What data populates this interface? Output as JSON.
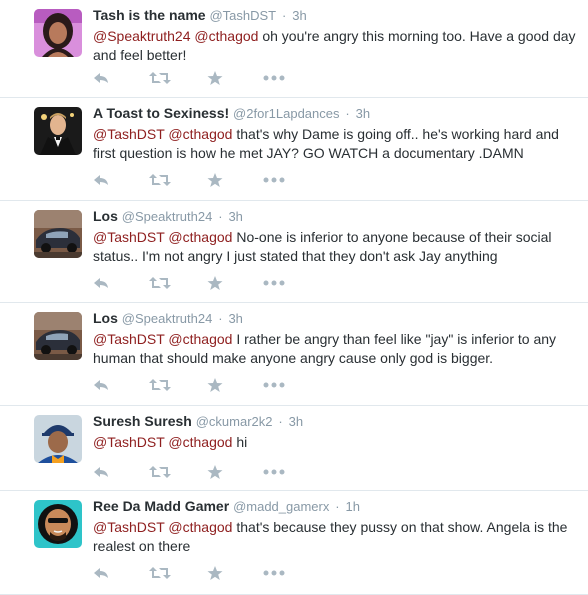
{
  "tweets": [
    {
      "fullname": "Tash is the name",
      "username": "@TashDST",
      "sep": "·",
      "time": "3h",
      "mentions": [
        "@Speaktruth24",
        "@cthagod"
      ],
      "text": "oh you're angry this morning too. Have a good day and feel better!",
      "avatar": "avatar-woman-pink"
    },
    {
      "fullname": "A Toast to Sexiness!",
      "username": "@2for1Lapdances",
      "sep": "·",
      "time": "3h",
      "mentions": [
        "@TashDST",
        "@cthagod"
      ],
      "text": "that's why Dame is going off.. he's working hard and first question is how he met JAY?   GO WATCH a documentary .DAMN",
      "avatar": "avatar-man-tuxedo"
    },
    {
      "fullname": "Los",
      "username": "@Speaktruth24",
      "sep": "·",
      "time": "3h",
      "mentions": [
        "@TashDST",
        "@cthagod"
      ],
      "text": "No-one is inferior to anyone because of their social status.. I'm not angry I just stated that they don't ask Jay anything",
      "avatar": "avatar-car"
    },
    {
      "fullname": "Los",
      "username": "@Speaktruth24",
      "sep": "·",
      "time": "3h",
      "mentions": [
        "@TashDST",
        "@cthagod"
      ],
      "text": "I rather be angry than feel like \"jay\" is inferior to any human that should make anyone angry cause only god is bigger.",
      "avatar": "avatar-car"
    },
    {
      "fullname": "Suresh Suresh",
      "username": "@ckumar2k2",
      "sep": "·",
      "time": "3h",
      "mentions": [
        "@TashDST",
        "@cthagod"
      ],
      "text": "hi",
      "avatar": "avatar-cricketer"
    },
    {
      "fullname": "Ree Da Madd Gamer",
      "username": "@madd_gamerx",
      "sep": "·",
      "time": "1h",
      "mentions": [
        "@TashDST",
        "@cthagod"
      ],
      "text": "that's because they pussy on that show. Angela is the realest on there",
      "avatar": "avatar-man-cartoon"
    }
  ],
  "colors": {
    "mention": "#8e1e1e",
    "muted": "#8899a6",
    "icon": "#aab8c2",
    "border": "#e1e8ed"
  },
  "icons": [
    "reply-icon",
    "retweet-icon",
    "favorite-icon",
    "more-icon"
  ]
}
